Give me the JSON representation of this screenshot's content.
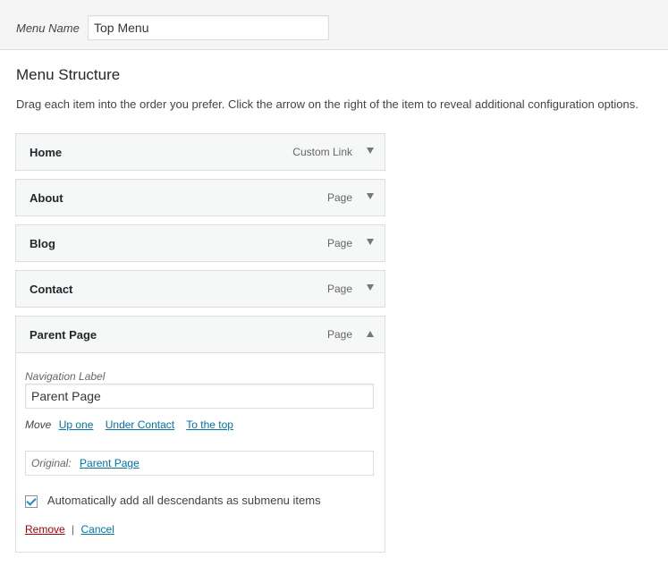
{
  "header": {
    "menu_name_label": "Menu Name",
    "menu_name_value": "Top Menu"
  },
  "structure": {
    "title": "Menu Structure",
    "instructions": "Drag each item into the order you prefer. Click the arrow on the right of the item to reveal additional configuration options."
  },
  "items": [
    {
      "title": "Home",
      "type": "Custom Link"
    },
    {
      "title": "About",
      "type": "Page"
    },
    {
      "title": "Blog",
      "type": "Page"
    },
    {
      "title": "Contact",
      "type": "Page"
    },
    {
      "title": "Parent Page",
      "type": "Page"
    }
  ],
  "settings": {
    "nav_label": "Navigation Label",
    "nav_value": "Parent Page",
    "move_label": "Move",
    "move_up": "Up one",
    "move_under": "Under Contact",
    "move_top": "To the top",
    "original_label": "Original:",
    "original_link": "Parent Page",
    "auto_add_label": "Automatically add all descendants as submenu items",
    "auto_add_checked": true,
    "remove": "Remove",
    "separator": "|",
    "cancel": "Cancel"
  },
  "colors": {
    "link": "#0073aa",
    "remove": "#aa0000",
    "item_bg": "#f6f7f7",
    "border": "#dddddd"
  },
  "icons": {
    "collapsed": "arrow-down-icon",
    "expanded": "arrow-up-icon"
  }
}
